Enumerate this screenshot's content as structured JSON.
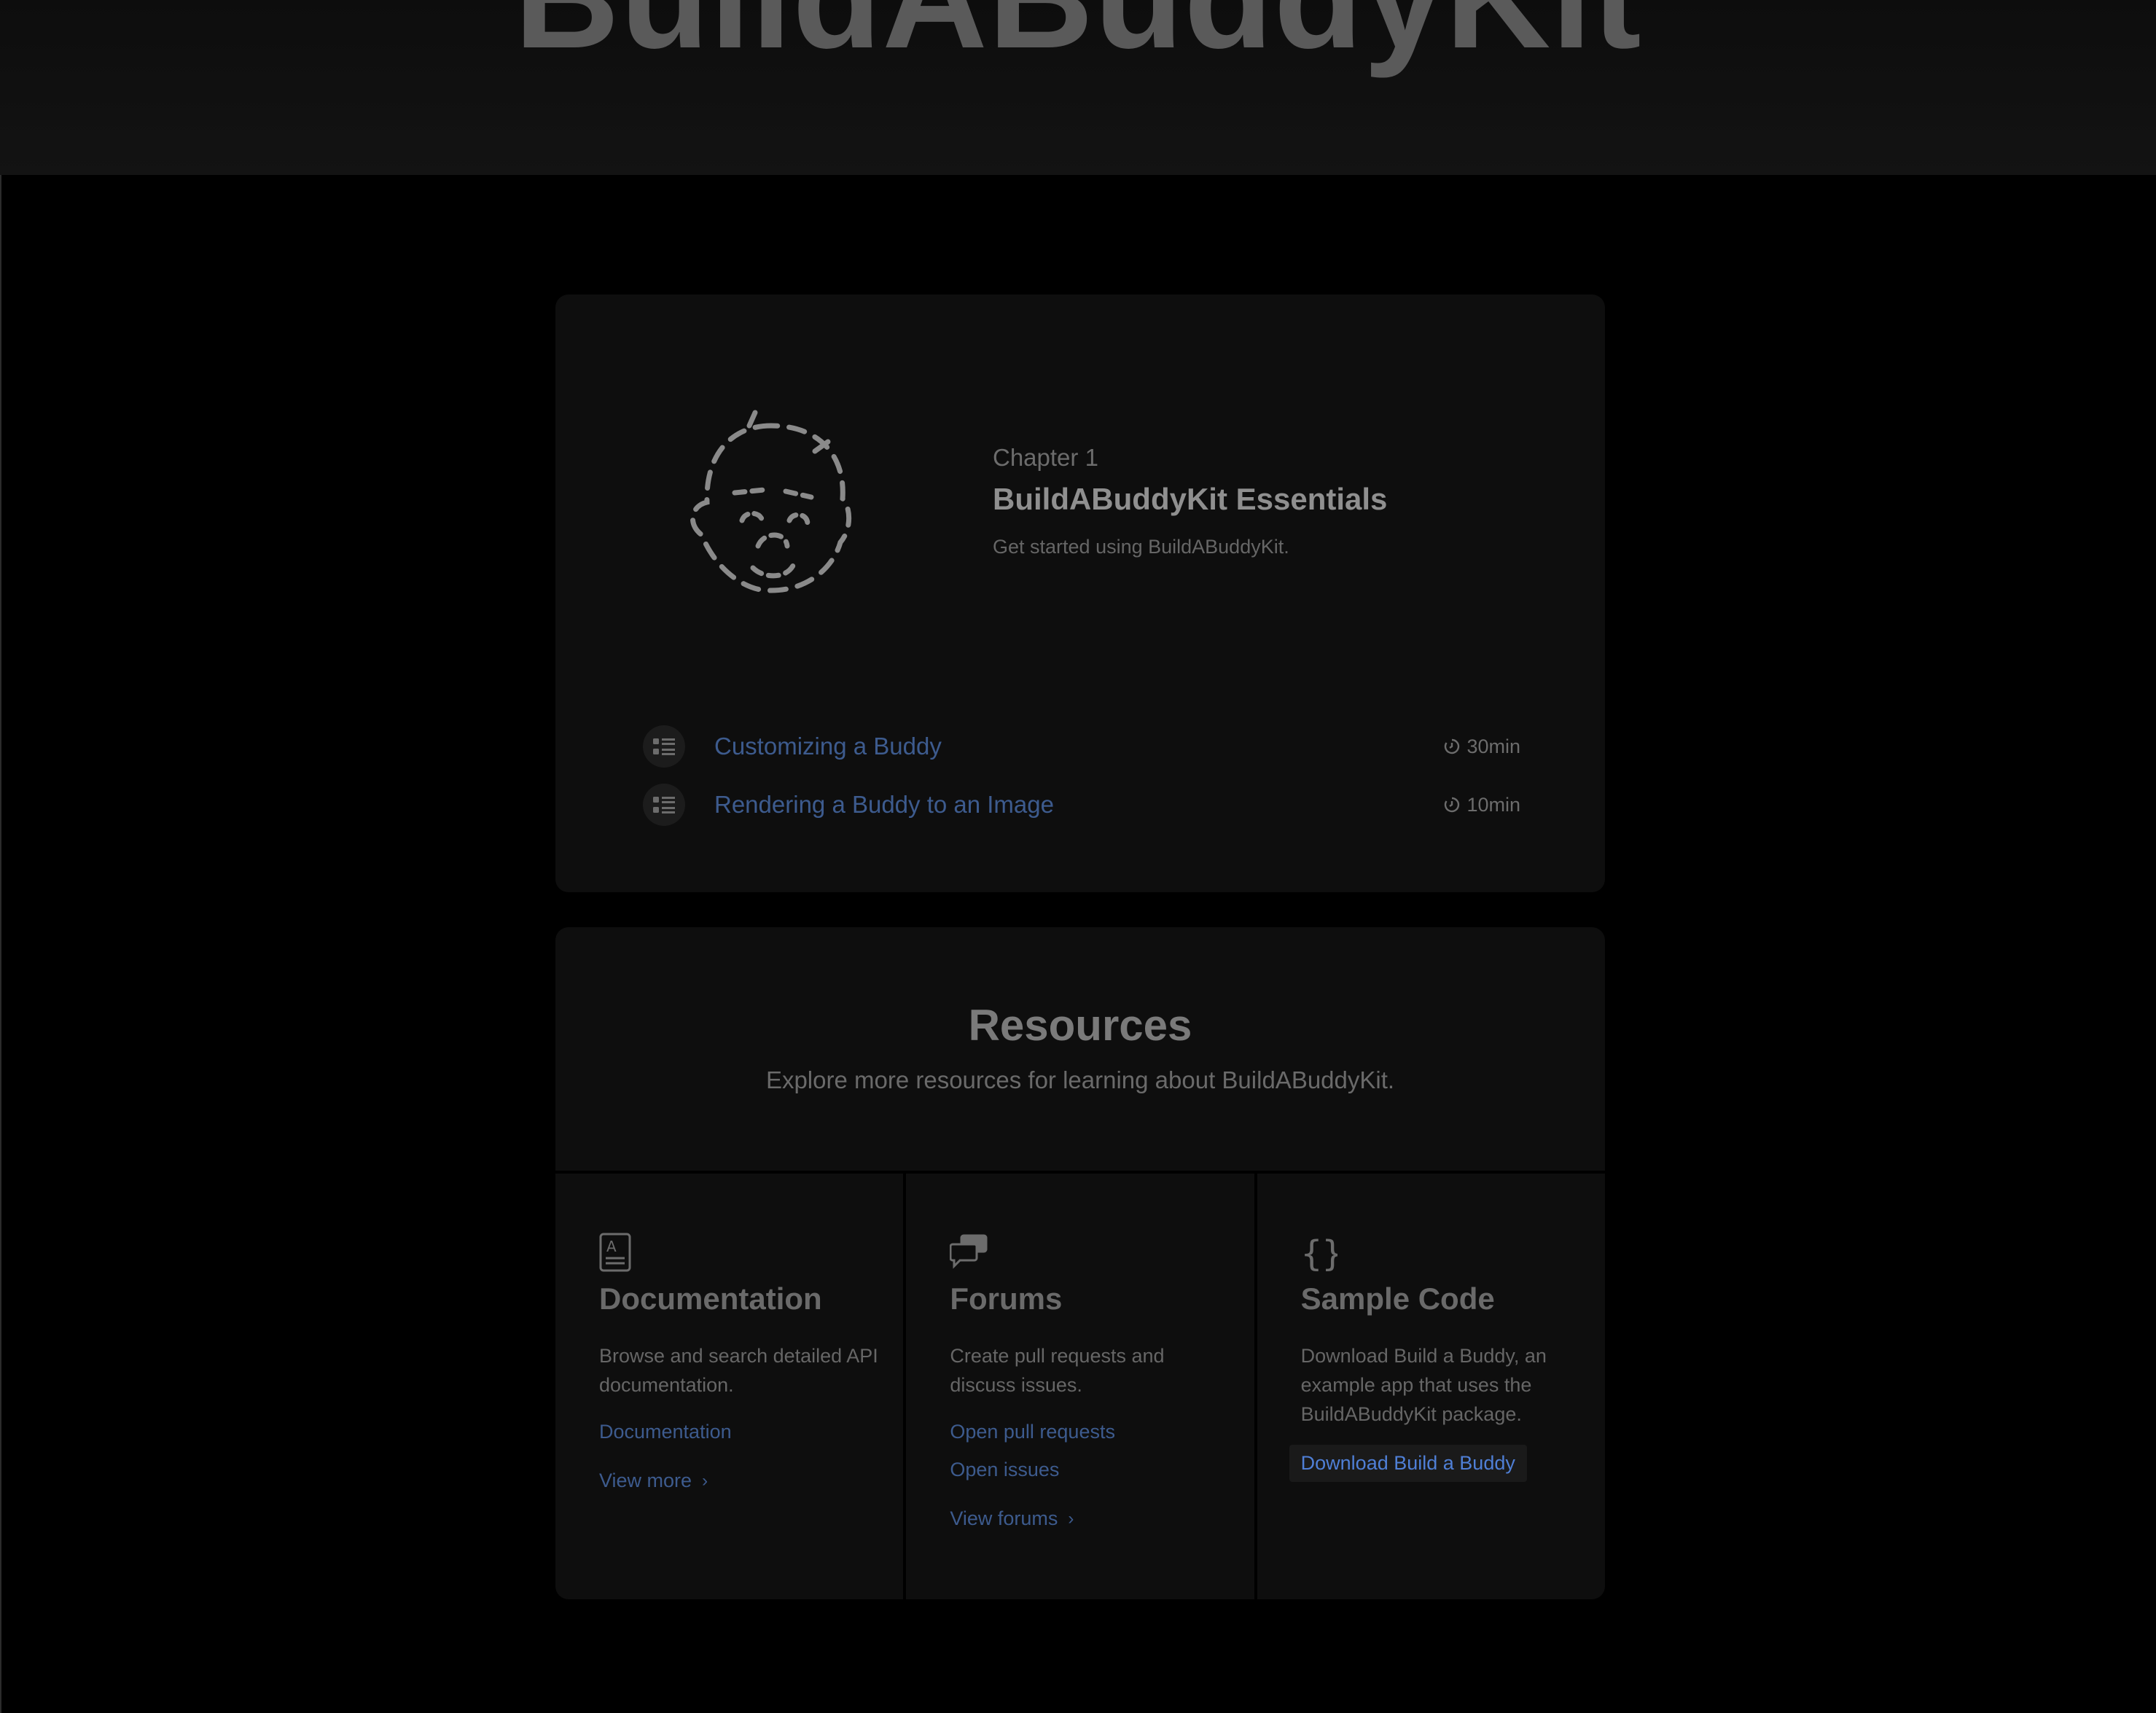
{
  "hero": {
    "title": "BuildABuddyKit"
  },
  "chapter": {
    "label": "Chapter 1",
    "title": "BuildABuddyKit Essentials",
    "description": "Get started using BuildABuddyKit.",
    "art_icon": "buddy-face-icon",
    "tutorials": [
      {
        "label": "Customizing a Buddy",
        "time": "30min",
        "icon": "tutorial-list-icon"
      },
      {
        "label": "Rendering a Buddy to an Image",
        "time": "10min",
        "icon": "tutorial-list-icon"
      }
    ]
  },
  "resources": {
    "title": "Resources",
    "subtitle": "Explore more resources for learning about BuildABuddyKit.",
    "documentation": {
      "icon": "documentation-icon",
      "title": "Documentation",
      "description": "Browse and search detailed API documentation.",
      "link": "Documentation",
      "more": "View more"
    },
    "forums": {
      "icon": "forums-icon",
      "title": "Forums",
      "description": "Create pull requests and discuss issues.",
      "links": [
        "Open pull requests",
        "Open issues"
      ],
      "more": "View forums"
    },
    "sample_code": {
      "icon": "curly-braces-icon",
      "title": "Sample Code",
      "description": "Download Build a Buddy, an example app that uses the BuildABuddyKit package.",
      "button": "Download Build a Buddy"
    }
  },
  "colors": {
    "background": "#000000",
    "card": "#0e0e0e",
    "link": "#3d5b8e",
    "link_highlight": "#4f7fd6"
  }
}
